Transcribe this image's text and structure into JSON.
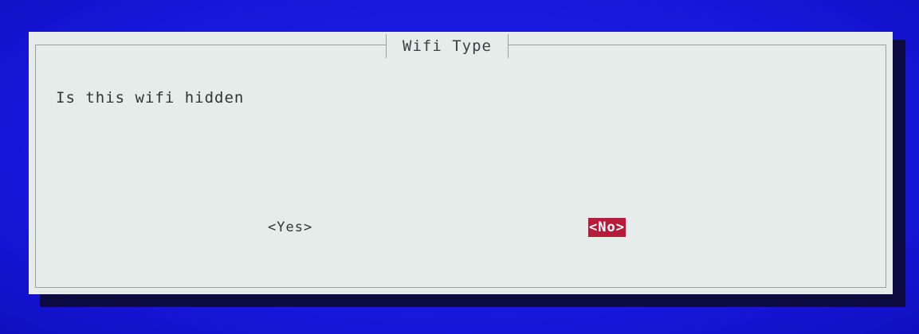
{
  "dialog": {
    "title": "Wifi Type",
    "message": "Is this wifi hidden",
    "yes_label": "<Yes>",
    "no_label": "<No>",
    "selected_button": "No"
  },
  "colors": {
    "screen_background": "#1a1ae6",
    "dialog_background": "#e6ecea",
    "selected_button_background": "#b41c3c",
    "selected_button_text": "#ffffff"
  }
}
